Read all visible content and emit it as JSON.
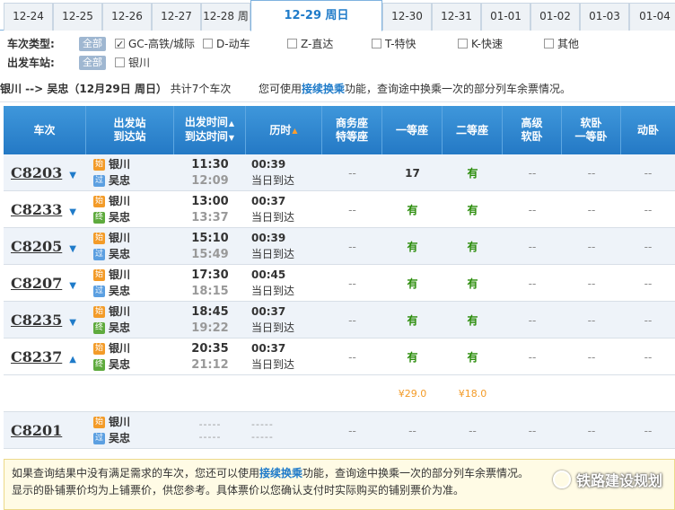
{
  "date_tabs": [
    {
      "label": "12-24",
      "active": false
    },
    {
      "label": "12-25",
      "active": false
    },
    {
      "label": "12-26",
      "active": false
    },
    {
      "label": "12-27",
      "active": false
    },
    {
      "label": "12-28 周",
      "active": false
    },
    {
      "label": "12-29 周日",
      "active": true
    },
    {
      "label": "12-30",
      "active": false
    },
    {
      "label": "12-31",
      "active": false
    },
    {
      "label": "01-01",
      "active": false
    },
    {
      "label": "01-02",
      "active": false
    },
    {
      "label": "01-03",
      "active": false
    },
    {
      "label": "01-04",
      "active": false
    }
  ],
  "filters": {
    "type_label": "车次类型:",
    "station_label": "出发车站:",
    "all_label": "全部",
    "types": [
      {
        "label": "GC-高铁/城际",
        "checked": true
      },
      {
        "label": "D-动车",
        "checked": false
      },
      {
        "label": "Z-直达",
        "checked": false
      },
      {
        "label": "T-特快",
        "checked": false
      },
      {
        "label": "K-快速",
        "checked": false
      },
      {
        "label": "其他",
        "checked": false
      }
    ],
    "stations": [
      {
        "label": "银川",
        "checked": false
      }
    ]
  },
  "summary": {
    "route": "银川 --> 吴忠（12月29日 周日）",
    "count": "共计7个车次",
    "hint_pre": "您可使用",
    "hint_link": "接续换乘",
    "hint_post": "功能，查询途中换乘一次的部分列车余票情况。"
  },
  "headers": {
    "train": "车次",
    "station_1": "出发站",
    "station_2": "到达站",
    "time_1": "出发时间",
    "time_2": "到达时间",
    "duration": "历时",
    "business_1": "商务座",
    "business_2": "特等座",
    "first": "一等座",
    "second": "二等座",
    "soft_deluxe_1": "高级",
    "soft_deluxe_2": "软卧",
    "soft_1": "软卧",
    "soft_2": "一等卧",
    "dong": "动卧"
  },
  "badges": {
    "start": "始",
    "pass": "过",
    "end": "终"
  },
  "trains": [
    {
      "no": "C8203",
      "from": "银川",
      "to": "吴忠",
      "to_badge": "pass",
      "dep": "11:30",
      "arr": "12:09",
      "dur": "00:39",
      "day": "当日到达",
      "business": "--",
      "first": "17",
      "second": "有",
      "deluxe": "--",
      "soft": "--",
      "dong": "--",
      "arrow": "down"
    },
    {
      "no": "C8233",
      "from": "银川",
      "to": "吴忠",
      "to_badge": "end",
      "dep": "13:00",
      "arr": "13:37",
      "dur": "00:37",
      "day": "当日到达",
      "business": "--",
      "first": "有",
      "second": "有",
      "deluxe": "--",
      "soft": "--",
      "dong": "--",
      "arrow": "down"
    },
    {
      "no": "C8205",
      "from": "银川",
      "to": "吴忠",
      "to_badge": "pass",
      "dep": "15:10",
      "arr": "15:49",
      "dur": "00:39",
      "day": "当日到达",
      "business": "--",
      "first": "有",
      "second": "有",
      "deluxe": "--",
      "soft": "--",
      "dong": "--",
      "arrow": "down"
    },
    {
      "no": "C8207",
      "from": "银川",
      "to": "吴忠",
      "to_badge": "pass",
      "dep": "17:30",
      "arr": "18:15",
      "dur": "00:45",
      "day": "当日到达",
      "business": "--",
      "first": "有",
      "second": "有",
      "deluxe": "--",
      "soft": "--",
      "dong": "--",
      "arrow": "down"
    },
    {
      "no": "C8235",
      "from": "银川",
      "to": "吴忠",
      "to_badge": "end",
      "dep": "18:45",
      "arr": "19:22",
      "dur": "00:37",
      "day": "当日到达",
      "business": "--",
      "first": "有",
      "second": "有",
      "deluxe": "--",
      "soft": "--",
      "dong": "--",
      "arrow": "down"
    },
    {
      "no": "C8237",
      "from": "银川",
      "to": "吴忠",
      "to_badge": "end",
      "dep": "20:35",
      "arr": "21:12",
      "dur": "00:37",
      "day": "当日到达",
      "business": "--",
      "first": "有",
      "second": "有",
      "deluxe": "--",
      "soft": "--",
      "dong": "--",
      "arrow": "up"
    }
  ],
  "price_row": {
    "first": "¥29.0",
    "second": "¥18.0"
  },
  "last_train": {
    "no": "C8201",
    "from": "银川",
    "to": "吴忠",
    "to_badge": "pass",
    "time_dash": "-----",
    "dur_dash": "-----",
    "business": "--",
    "first": "--",
    "second": "--",
    "deluxe": "--",
    "soft": "--",
    "dong": "--"
  },
  "note": {
    "line1_pre": "如果查询结果中没有满足需求的车次，您还可以使用",
    "line1_link": "接续换乘",
    "line1_post": "功能，查询途中换乘一次的部分列车余票情况。",
    "line2": "显示的卧铺票价均为上铺票价，供您参考。具体票价以您确认支付时实际购买的铺别票价为准。"
  },
  "watermark": "铁路建设规划",
  "colors": {
    "header_blue": "#2479c5",
    "avail_green": "#2a8c0a",
    "price_orange": "#f39b28",
    "link_blue": "#1f7bc9"
  }
}
